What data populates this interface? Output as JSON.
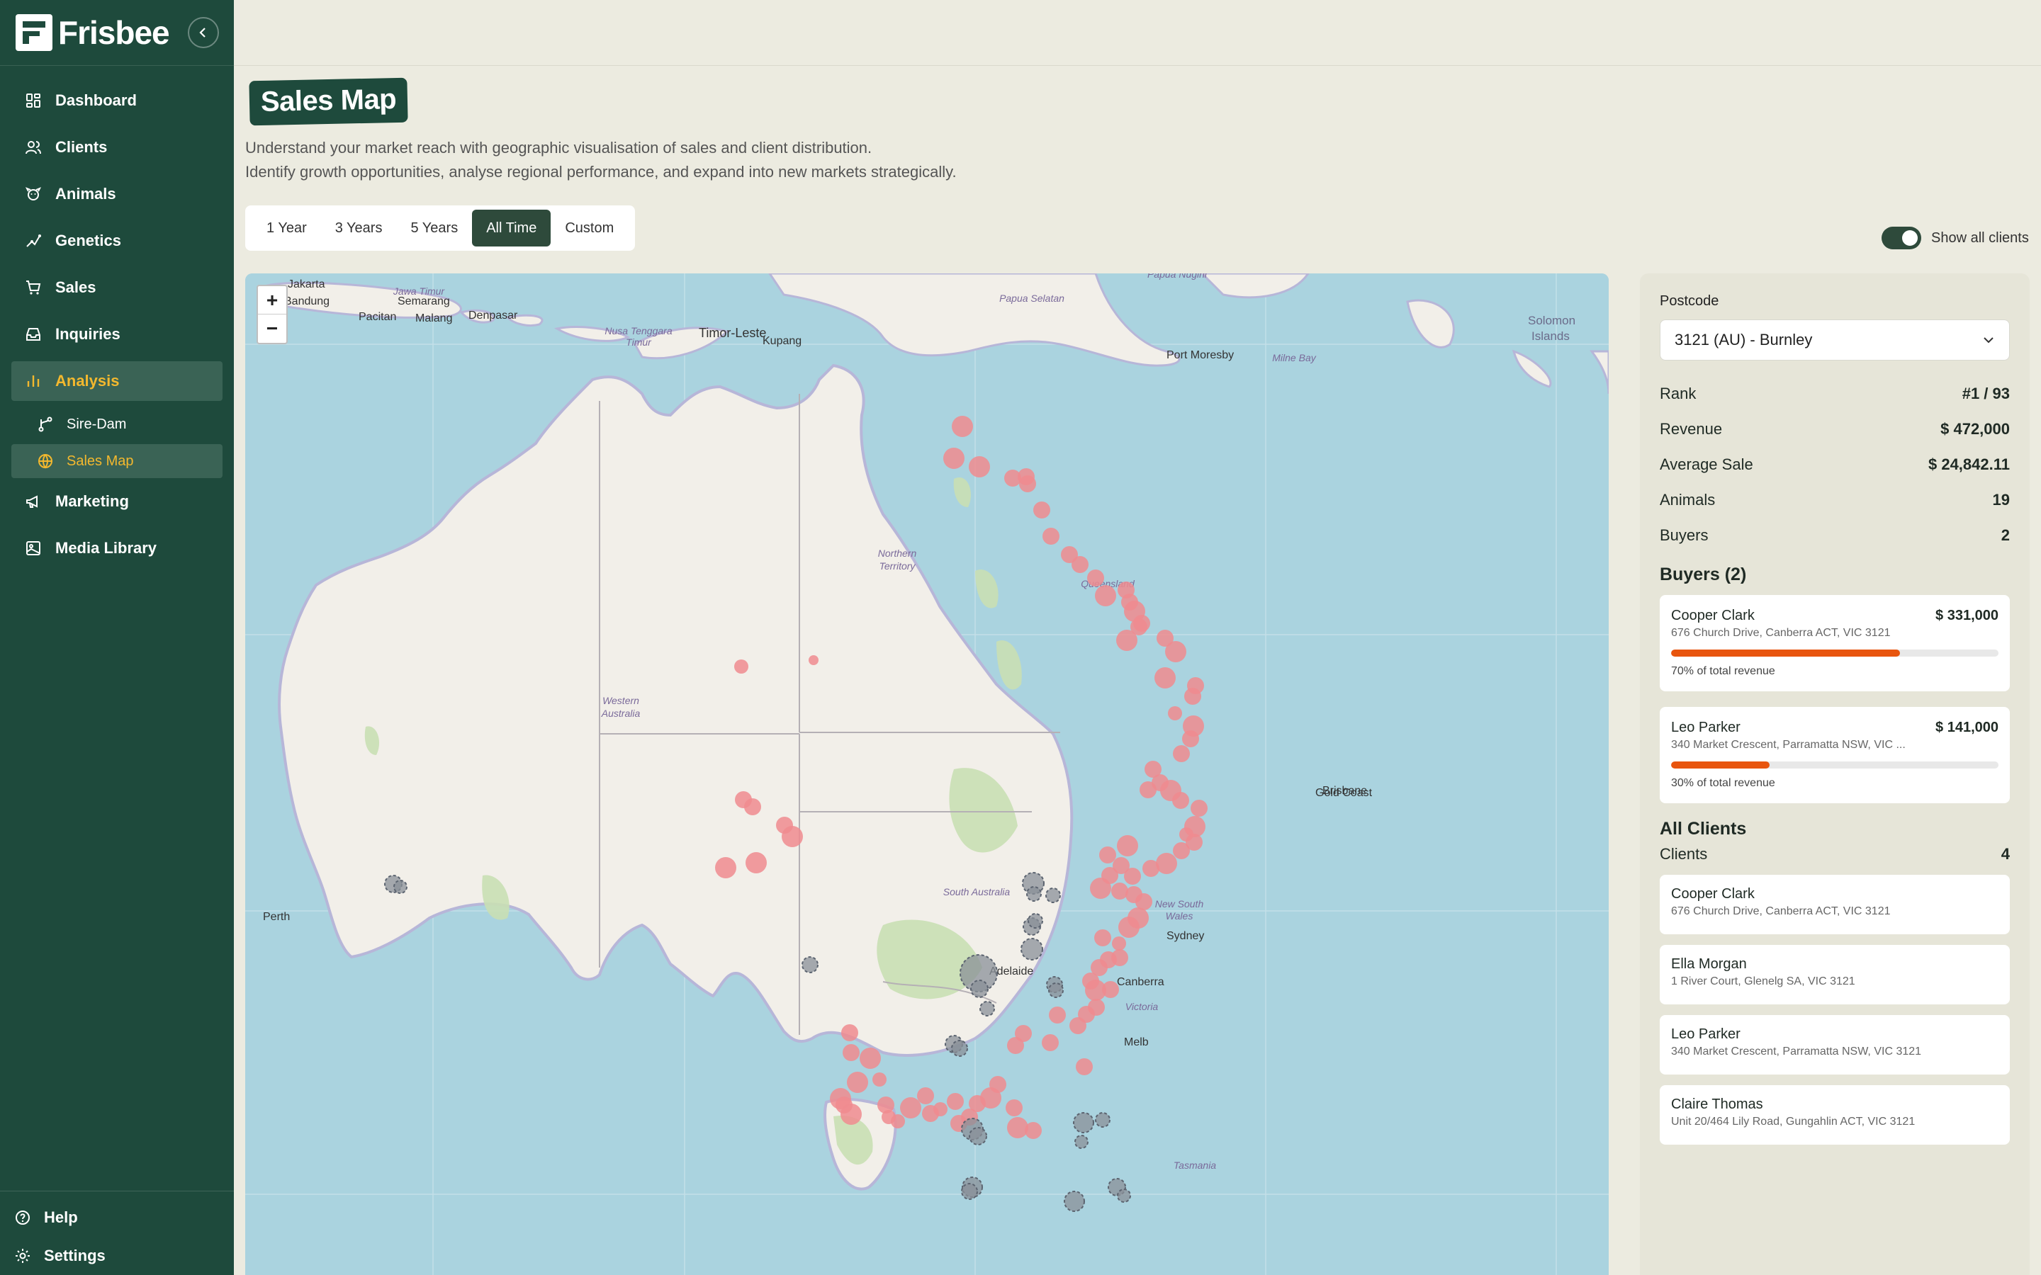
{
  "app": {
    "name": "Frisbee"
  },
  "sidebar": {
    "items": [
      {
        "label": "Dashboard",
        "icon": "grid-icon"
      },
      {
        "label": "Clients",
        "icon": "users-icon"
      },
      {
        "label": "Animals",
        "icon": "animal-icon"
      },
      {
        "label": "Genetics",
        "icon": "genetics-icon"
      },
      {
        "label": "Sales",
        "icon": "cart-icon"
      },
      {
        "label": "Inquiries",
        "icon": "inbox-icon"
      },
      {
        "label": "Analysis",
        "icon": "bar-chart-icon",
        "active": true
      },
      {
        "label": "Marketing",
        "icon": "megaphone-icon"
      },
      {
        "label": "Media Library",
        "icon": "images-icon"
      }
    ],
    "sub_items": [
      {
        "label": "Sire-Dam",
        "icon": "branch-icon"
      },
      {
        "label": "Sales Map",
        "icon": "globe-icon",
        "active": true
      }
    ],
    "bottom": [
      {
        "label": "Help",
        "icon": "help-icon"
      },
      {
        "label": "Settings",
        "icon": "gear-icon"
      }
    ]
  },
  "page": {
    "title": "Sales Map",
    "subtitle_line1": "Understand your market reach with geographic visualisation of sales and client distribution.",
    "subtitle_line2": "Identify growth opportunities, analyse regional performance, and expand into new markets strategically."
  },
  "range_tabs": [
    {
      "label": "1 Year"
    },
    {
      "label": "3 Years"
    },
    {
      "label": "5 Years"
    },
    {
      "label": "All Time",
      "active": true
    },
    {
      "label": "Custom"
    }
  ],
  "toggle": {
    "label": "Show all clients",
    "on": true
  },
  "map": {
    "zoom_in": "+",
    "zoom_out": "−",
    "labels": {
      "jakarta": "Jakarta",
      "bandung": "Bandung",
      "semarang": "Semarang",
      "pacitan": "Pacitan",
      "malang": "Malang",
      "denpasar": "Denpasar",
      "jawa_timur": "Jawa Timur",
      "nusa_tenggara": "Nusa Tenggara",
      "timur": "Timur",
      "timor_leste": "Timor-Leste",
      "kupang": "Kupang",
      "papua_selatan": "Papua Selatan",
      "papua_nugini": "Papua Nugini",
      "port_moresby": "Port Moresby",
      "milne_bay": "Milne Bay",
      "solomon": "Solomon",
      "islands": "Islands",
      "northern": "Northern",
      "territory": "Territory",
      "western": "Western",
      "australia_w": "Australia",
      "queensland": "Queensland",
      "south_australia": "South Australia",
      "new_south": "New South",
      "wales": "Wales",
      "victoria": "Victoria",
      "tasmania": "Tasmania",
      "perth": "Perth",
      "adelaide": "Adelaide",
      "melbourne": "Melb",
      "canberra": "Canberra",
      "sydney": "Sydney",
      "brisbane": "Brisbane",
      "gold_coast": "Gold Coast"
    },
    "colors": {
      "sea": "#aad3df",
      "land": "#f2efe9",
      "sale_marker": "#f08b8f",
      "client_marker": "#5c6470"
    }
  },
  "panel": {
    "postcode_label": "Postcode",
    "postcode_value": "3121 (AU) - Burnley",
    "stats": [
      {
        "label": "Rank",
        "value": "#1 / 93"
      },
      {
        "label": "Revenue",
        "value": "$ 472,000"
      },
      {
        "label": "Average Sale",
        "value": "$ 24,842.11"
      },
      {
        "label": "Animals",
        "value": "19"
      },
      {
        "label": "Buyers",
        "value": "2"
      }
    ],
    "buyers_title": "Buyers (2)",
    "buyers": [
      {
        "name": "Cooper Clark",
        "amount": "$ 331,000",
        "address": "676 Church Drive, Canberra ACT, VIC 3121",
        "share": 0.7,
        "share_label": "70% of total revenue"
      },
      {
        "name": "Leo Parker",
        "amount": "$ 141,000",
        "address": "340 Market Crescent, Parramatta NSW, VIC ...",
        "share": 0.3,
        "share_label": "30% of total revenue"
      }
    ],
    "all_clients_title": "All Clients",
    "clients_label": "Clients",
    "clients_count": "4",
    "clients": [
      {
        "name": "Cooper Clark",
        "address": "676 Church Drive, Canberra ACT, VIC 3121"
      },
      {
        "name": "Ella Morgan",
        "address": "1 River Court, Glenelg SA, VIC 3121"
      },
      {
        "name": "Leo Parker",
        "address": "340 Market Crescent, Parramatta NSW, VIC 3121"
      },
      {
        "name": "Claire Thomas",
        "address": "Unit 20/464 Lily Road, Gungahlin ACT, VIC 3121"
      }
    ]
  }
}
